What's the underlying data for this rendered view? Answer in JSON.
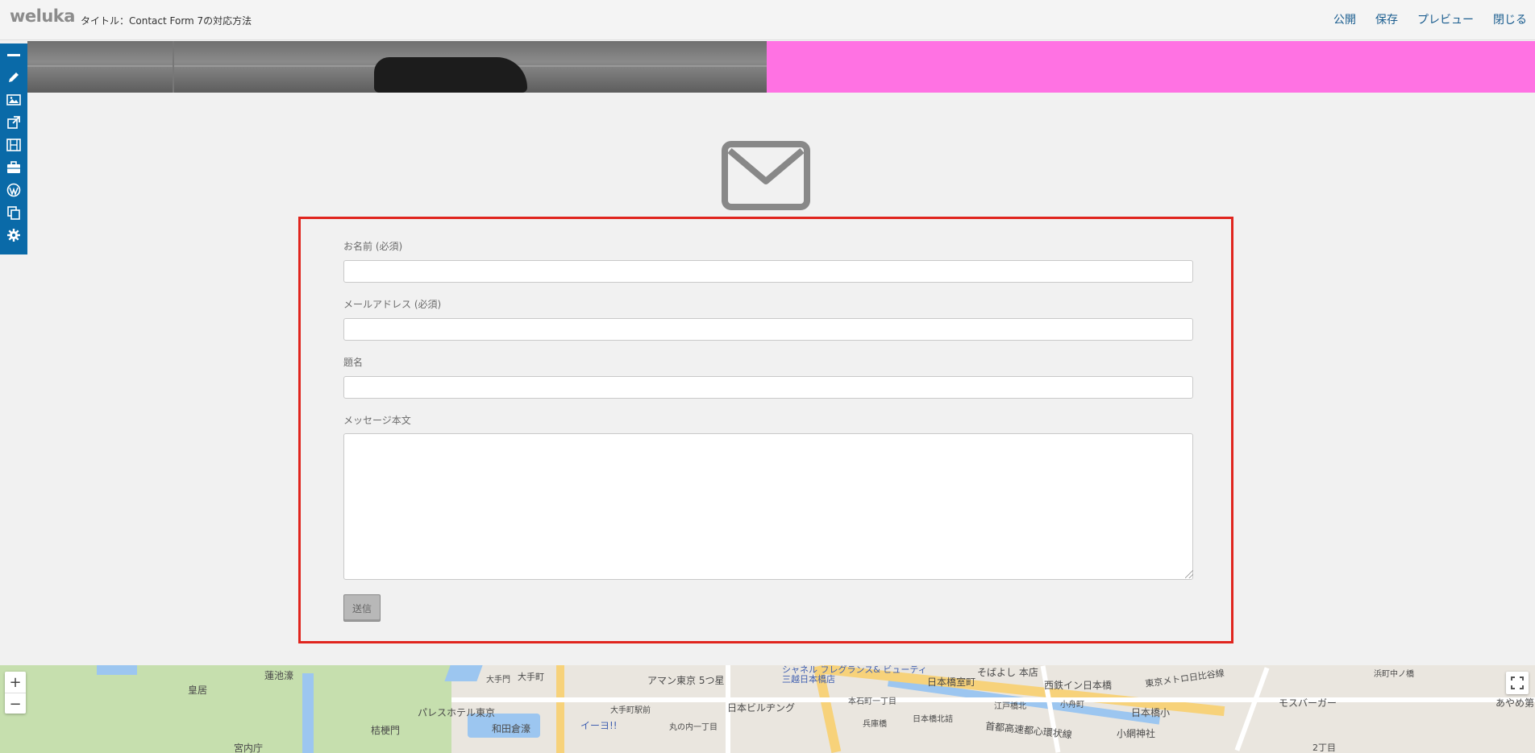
{
  "header": {
    "logo": "weluka",
    "title": "タイトル：Contact Form 7の対応方法",
    "actions": [
      "公開",
      "保存",
      "プレビュー",
      "閉じる"
    ]
  },
  "toolbar": {
    "icons": [
      "minus-icon",
      "pencil-icon",
      "image-icon",
      "external-link-icon",
      "film-icon",
      "briefcase-icon",
      "wordpress-icon",
      "copy-icon",
      "gear-icon"
    ]
  },
  "form": {
    "name_label": "お名前 (必須)",
    "email_label": "メールアドレス (必須)",
    "subject_label": "題名",
    "message_label": "メッセージ本文",
    "submit_label": "送信",
    "name_value": "",
    "email_value": "",
    "subject_value": "",
    "message_value": ""
  },
  "map": {
    "zoom_in": "+",
    "zoom_out": "−",
    "labels": [
      "蓮池濠",
      "皇居",
      "パレスホテル東京",
      "和田倉濠",
      "桔梗門",
      "宮内庁",
      "大手門",
      "大手町",
      "アマン東京 5つ星",
      "大手町駅前",
      "イーヨ!!",
      "丸の内一丁目",
      "日本ビルヂング",
      "シャネル フレグランス& ビューティ 三越日本橋店",
      "本石町一丁目",
      "兵庫橋",
      "日本橋北詰",
      "そばよし 本店",
      "日本橋室町",
      "江戸橋北",
      "小舟町",
      "首都高速都心環状線",
      "西鉄イン日本橋",
      "東京メトロ日比谷線",
      "日本橋小",
      "小網神社",
      "浜町中ノ橋",
      "モスバーガー",
      "あやめ第",
      "2丁目"
    ]
  },
  "colors": {
    "accent": "#0a6aa8",
    "link": "#1a5d8f",
    "form_border": "#e0251e",
    "hero_pink": "#ff72e3"
  }
}
